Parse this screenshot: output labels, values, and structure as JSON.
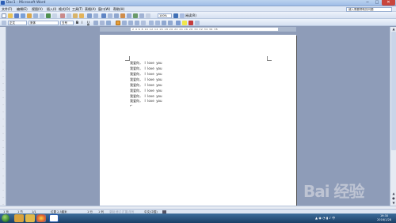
{
  "window": {
    "title": "Doc1 - Microsoft Word",
    "minimize": "─",
    "maximize": "□",
    "close": "✕"
  },
  "menu": {
    "items": [
      "文件(F)",
      "编辑(E)",
      "视图(V)",
      "插入(I)",
      "格式(O)",
      "工具(T)",
      "表格(A)",
      "窗口(W)",
      "帮助(H)"
    ],
    "help_placeholder": "键入需要帮助的问题"
  },
  "toolbar1": {
    "zoom": "100%",
    "read_label": "阅读(R)"
  },
  "toolbar2": {
    "style": "正文",
    "font": "宋体",
    "size": "五号",
    "bold": "B",
    "italic": "I",
    "underline": "U"
  },
  "ruler": {
    "numbers": "2  4  6  8  10  12  14  16  18  20  22  24  26  28  30  32  34  36  38"
  },
  "document": {
    "lines": [
      "我爱你，  I  love  you",
      "我爱你，  I  love  you",
      "我爱你，  I  love  you",
      "我爱你，  I  love  you",
      "我爱你，  I  love  you",
      "我爱你，  I  love  you",
      "我爱你，  I  love  you",
      "我爱你，  I  love  you"
    ],
    "paragraph_mark": "↵"
  },
  "statusbar": {
    "page": "1 页",
    "section": "1 节",
    "pages": "1/1",
    "position": "位置 2.5厘米",
    "line": "1 行",
    "column": "1 列",
    "modes": "录制  修订  扩展  改写",
    "language": "中文(中国)"
  },
  "taskbar": {
    "time": "19:30",
    "date": "2016/1/28",
    "tray": "▲ ◉ ◔ ▮ ♪ 中"
  },
  "watermark": "Bai 经验",
  "colors": {
    "background": "#8e9cb8",
    "page": "#ffffff",
    "close_button": "#c8453c"
  }
}
